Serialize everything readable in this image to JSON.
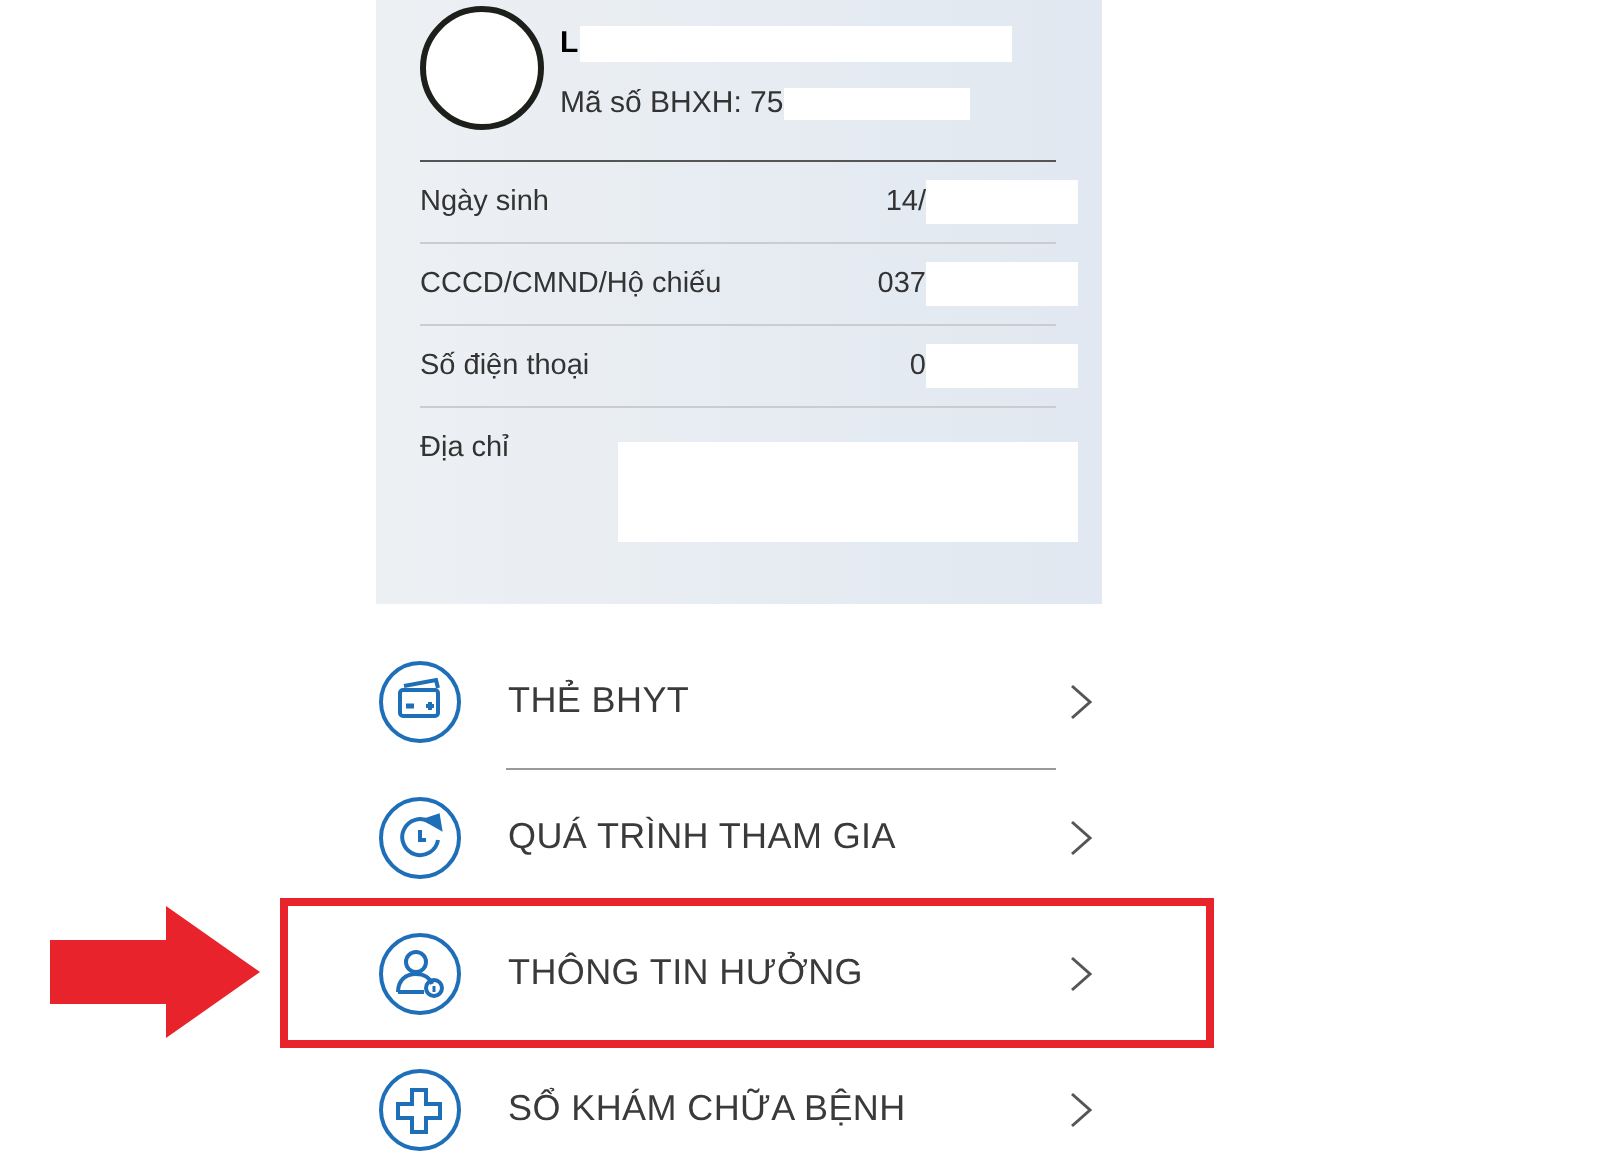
{
  "profile": {
    "name": "L",
    "insurance_number": "Mã số BHXH: 75"
  },
  "details": [
    {
      "label": "Ngày sinh",
      "value": "14/"
    },
    {
      "label": "CCCD/CMND/Hộ chiếu",
      "value": "037"
    },
    {
      "label": "Số điện thoại",
      "value": "0"
    },
    {
      "label": "Địa chỉ"
    }
  ],
  "menu": [
    {
      "label": "THẺ BHYT",
      "highlighted": false
    },
    {
      "label": "QUÁ TRÌNH THAM GIA",
      "highlighted": false
    },
    {
      "label": "THÔNG TIN HƯỞNG",
      "highlighted": true
    },
    {
      "label": "SỔ KHÁM CHỮA BỆNH",
      "highlighted": false
    }
  ]
}
